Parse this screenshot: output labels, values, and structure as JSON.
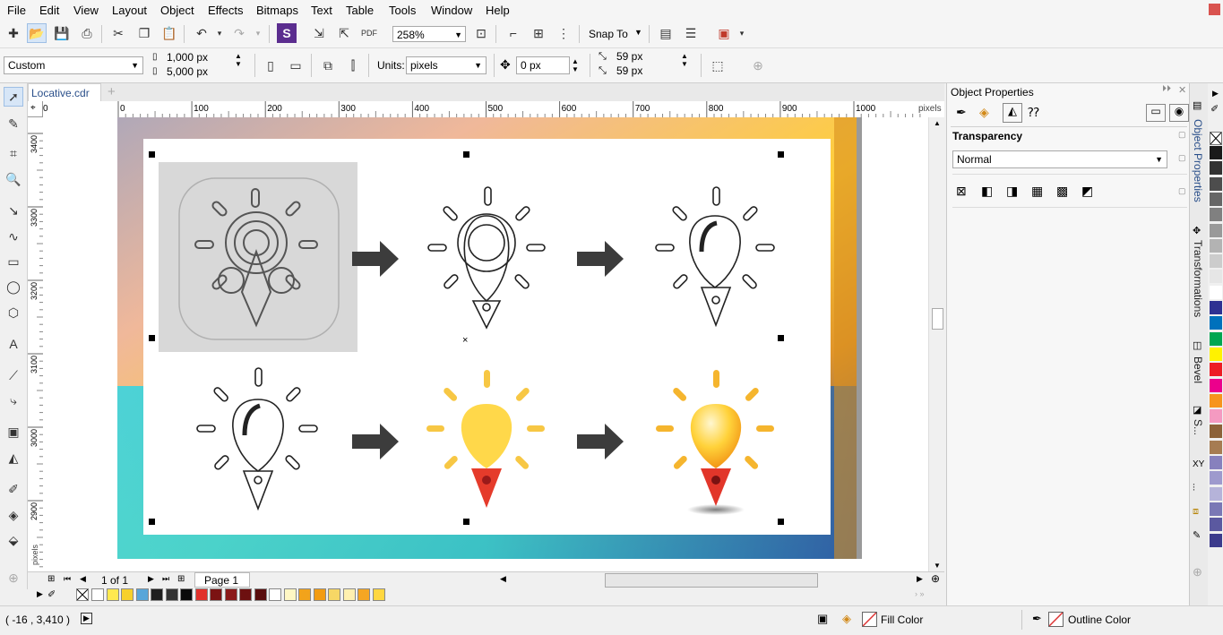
{
  "menu": [
    "File",
    "Edit",
    "View",
    "Layout",
    "Object",
    "Effects",
    "Bitmaps",
    "Text",
    "Table",
    "Tools",
    "Window",
    "Help"
  ],
  "toolbar": {
    "zoom": "258%",
    "snap_label": "Snap To"
  },
  "propbar": {
    "preset": "Custom",
    "width": "1,000 px",
    "height": "5,000 px",
    "units_label": "Units:",
    "units": "pixels",
    "nudge": "0 px",
    "dup_x": "59 px",
    "dup_y": "59 px"
  },
  "document": {
    "tab": "Locative.cdr",
    "page_info": "1 of 1",
    "page_tab": "Page 1"
  },
  "rulers": {
    "h_ticks": [
      "0",
      "100",
      "200",
      "300",
      "400",
      "500",
      "600",
      "700",
      "800",
      "900",
      "1000"
    ],
    "h_neg": "0",
    "units": "pixels",
    "v_ticks": [
      "3400",
      "3300",
      "3200",
      "3100",
      "3000",
      "2900"
    ],
    "v_units": "pixels"
  },
  "docker": {
    "title": "Object Properties",
    "section": "Transparency",
    "mode": "Normal",
    "tabs": [
      "Object Properties",
      "Transformations",
      "Bevel",
      "S..."
    ]
  },
  "status": {
    "coords": "( -16   , 3,410 )",
    "fill_label": "Fill Color",
    "outline_label": "Outline Color"
  },
  "palette_colors": [
    "#ffffff",
    "#ffe94f",
    "#f7d02b",
    "#58a6d9",
    "#1e1e1e",
    "#333333",
    "#0a0a0a",
    "#e1312b",
    "#7b1313",
    "#8b1a1a",
    "#6d1010",
    "#5a0d0d",
    "#ffffff",
    "#fff7c4",
    "#f2a31b",
    "#f39c12",
    "#f7d765",
    "#fff0b0",
    "#f5a623",
    "#ffd740"
  ],
  "right_palette": [
    "#1a1a1a",
    "#333333",
    "#4d4d4d",
    "#666666",
    "#808080",
    "#999999",
    "#b3b3b3",
    "#cccccc",
    "#e6e6e6",
    "#ffffff",
    "#2e3192",
    "#0071bc",
    "#00a651",
    "#fff200",
    "#ed1c24",
    "#ec008c",
    "#f7941d",
    "#f49ac1",
    "#8c6239",
    "#a67c52",
    "#8781bd",
    "#9e9acd",
    "#b5b3d9",
    "#7a78b5",
    "#5b59a0",
    "#3c3b8c"
  ]
}
